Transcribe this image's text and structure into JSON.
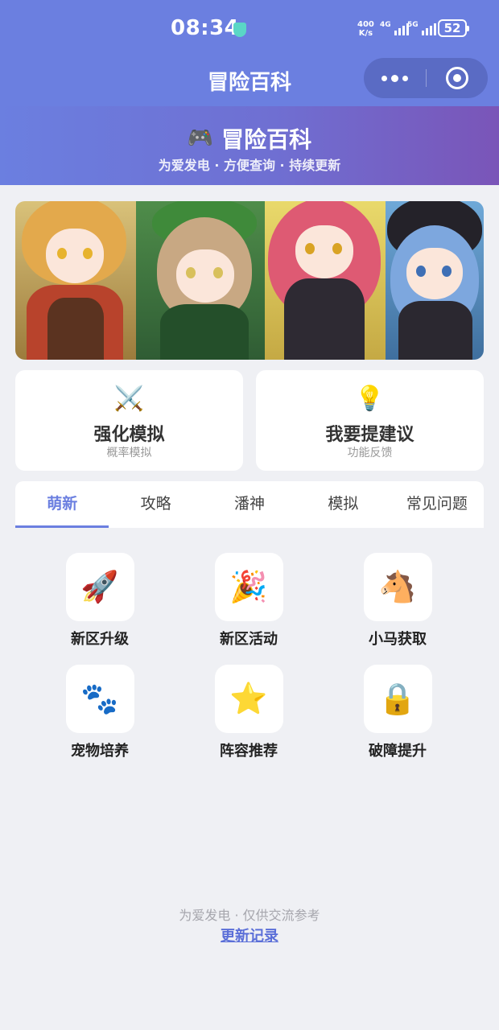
{
  "status_bar": {
    "time": "08:34",
    "net_speed_value": "400",
    "net_speed_unit": "K/s",
    "signal1_label": "4G",
    "signal2_label": "5G",
    "battery": "52"
  },
  "nav": {
    "title": "冒险百科"
  },
  "hero": {
    "icon": "🎮",
    "title": "冒险百科",
    "subtitle": "为爱发电 · 方便查询 · 持续更新"
  },
  "cards": [
    {
      "icon": "⚔️",
      "title": "强化模拟",
      "subtitle": "概率模拟"
    },
    {
      "icon": "💡",
      "title": "我要提建议",
      "subtitle": "功能反馈"
    }
  ],
  "tabs": [
    {
      "label": "萌新",
      "active": true
    },
    {
      "label": "攻略",
      "active": false
    },
    {
      "label": "潘神",
      "active": false
    },
    {
      "label": "模拟",
      "active": false
    },
    {
      "label": "常见问题",
      "active": false
    }
  ],
  "grid": [
    {
      "icon": "🚀",
      "label": "新区升级"
    },
    {
      "icon": "🎉",
      "label": "新区活动"
    },
    {
      "icon": "🐴",
      "label": "小马获取"
    },
    {
      "icon": "🐾",
      "label": "宠物培养"
    },
    {
      "icon": "⭐",
      "label": "阵容推荐"
    },
    {
      "icon": "🔒",
      "label": "破障提升"
    }
  ],
  "footer": {
    "note": "为爱发电 · 仅供交流参考",
    "link": "更新记录"
  },
  "colors": {
    "accent": "#6b7fe0",
    "hero_gradient_end": "#7a55b8"
  }
}
